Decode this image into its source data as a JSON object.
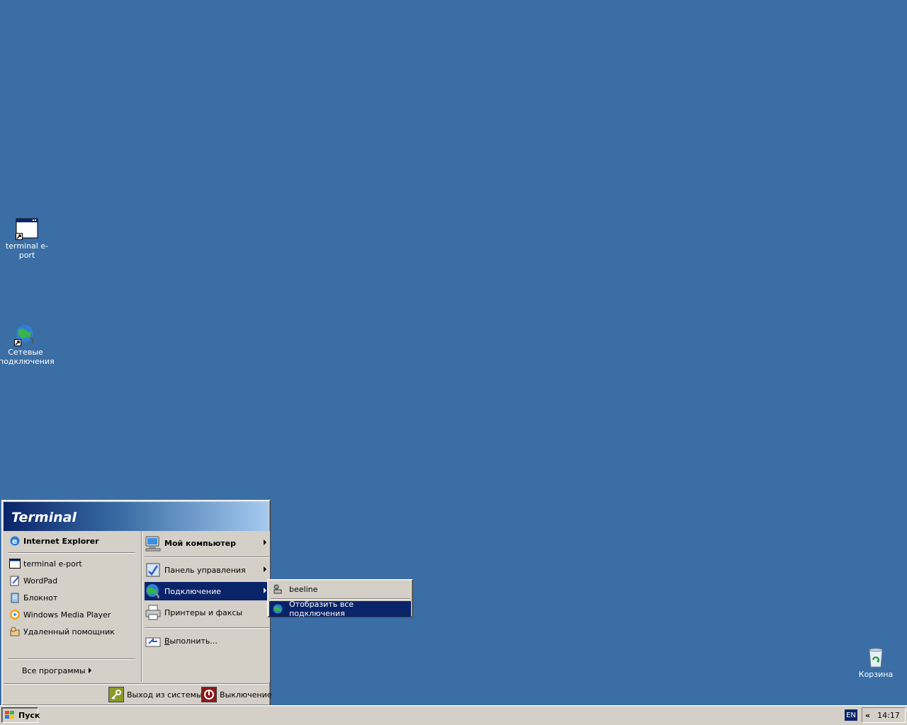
{
  "desktop": {
    "background_color": "#3a6ea5",
    "icons": [
      {
        "label": "terminal e-port",
        "icon": "window-app-icon"
      },
      {
        "label_line1": "Сетевые",
        "label_line2": "подключения",
        "icon": "network-connections-icon"
      },
      {
        "label": "Корзина",
        "icon": "recycle-bin-icon"
      }
    ]
  },
  "start_menu": {
    "header_title": "Terminal",
    "left": {
      "pinned": {
        "label": "Internet Explorer",
        "icon": "internet-explorer-icon"
      },
      "recent": [
        {
          "label": "terminal e-port",
          "icon": "window-app-icon"
        },
        {
          "label": "WordPad",
          "icon": "wordpad-icon"
        },
        {
          "label": "Блокнот",
          "icon": "notepad-icon"
        },
        {
          "label": "Windows Media Player",
          "icon": "media-player-icon"
        },
        {
          "label": "Удаленный помощник",
          "icon": "remote-assistance-icon"
        }
      ],
      "all_programs": "Все программы"
    },
    "right": {
      "items": [
        {
          "label": "Мой компьютер",
          "icon": "my-computer-icon"
        },
        {
          "label": "Панель управления",
          "icon": "control-panel-icon"
        },
        {
          "label": "Подключение",
          "icon": "network-globe-icon"
        },
        {
          "label": "Принтеры и факсы",
          "icon": "printer-icon"
        },
        {
          "label": "Выполнить...",
          "icon": "run-icon"
        }
      ]
    },
    "footer": {
      "logoff": "Выход из системы",
      "shutdown": "Выключение"
    }
  },
  "submenu": {
    "items": [
      {
        "label": "beeline",
        "icon": "dialup-connection-icon"
      },
      {
        "label": "Отобразить все подключения",
        "icon": "network-globe-icon"
      }
    ]
  },
  "taskbar": {
    "start_label": "Пуск",
    "language": "EN",
    "tray_chevron": "«",
    "clock": "14:17"
  }
}
